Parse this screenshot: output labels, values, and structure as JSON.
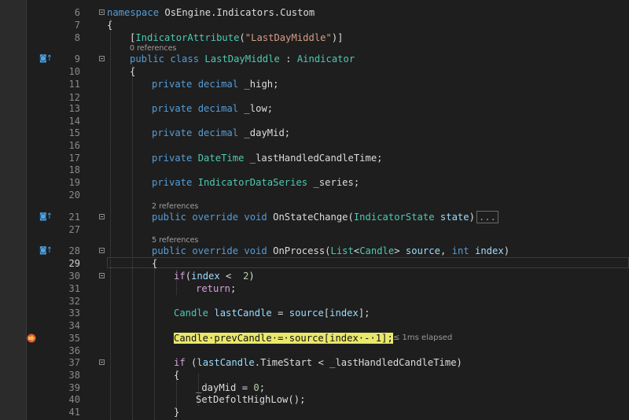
{
  "lines": [
    {
      "num": "6",
      "tokens": [
        [
          "kw",
          "namespace"
        ],
        [
          "pl",
          " OsEngine.Indicators.Custom"
        ]
      ]
    },
    {
      "num": "7",
      "tokens": [
        [
          "pl",
          "{"
        ]
      ]
    },
    {
      "num": "8",
      "tokens": [
        [
          "pl",
          "["
        ],
        [
          "ty",
          "IndicatorAttribute"
        ],
        [
          "pl",
          "("
        ],
        [
          "str",
          "\"LastDayMiddle\""
        ],
        [
          "pl",
          ")]"
        ]
      ]
    },
    {
      "num": "9",
      "tokens": [
        [
          "kw",
          "public"
        ],
        [
          "pl",
          " "
        ],
        [
          "kw",
          "class"
        ],
        [
          "pl",
          " "
        ],
        [
          "ty",
          "LastDayMiddle"
        ],
        [
          "pl",
          " : "
        ],
        [
          "ty",
          "Aindicator"
        ]
      ]
    },
    {
      "num": "10",
      "tokens": [
        [
          "pl",
          "{"
        ]
      ]
    },
    {
      "num": "11",
      "tokens": [
        [
          "kw",
          "private"
        ],
        [
          "pl",
          " "
        ],
        [
          "kw",
          "decimal"
        ],
        [
          "pl",
          " _high;"
        ]
      ]
    },
    {
      "num": "12",
      "tokens": []
    },
    {
      "num": "13",
      "tokens": [
        [
          "kw",
          "private"
        ],
        [
          "pl",
          " "
        ],
        [
          "kw",
          "decimal"
        ],
        [
          "pl",
          " _low;"
        ]
      ]
    },
    {
      "num": "14",
      "tokens": []
    },
    {
      "num": "15",
      "tokens": [
        [
          "kw",
          "private"
        ],
        [
          "pl",
          " "
        ],
        [
          "kw",
          "decimal"
        ],
        [
          "pl",
          " _dayMid;"
        ]
      ]
    },
    {
      "num": "16",
      "tokens": []
    },
    {
      "num": "17",
      "tokens": [
        [
          "kw",
          "private"
        ],
        [
          "pl",
          " "
        ],
        [
          "ty",
          "DateTime"
        ],
        [
          "pl",
          " _lastHandledCandleTime;"
        ]
      ]
    },
    {
      "num": "18",
      "tokens": []
    },
    {
      "num": "19",
      "tokens": [
        [
          "kw",
          "private"
        ],
        [
          "pl",
          " "
        ],
        [
          "ty",
          "IndicatorDataSeries"
        ],
        [
          "pl",
          " _series;"
        ]
      ]
    },
    {
      "num": "20",
      "tokens": []
    },
    {
      "num": "21",
      "tokens": [
        [
          "kw",
          "public"
        ],
        [
          "pl",
          " "
        ],
        [
          "kw",
          "override"
        ],
        [
          "pl",
          " "
        ],
        [
          "kw",
          "void"
        ],
        [
          "pl",
          " OnStateChange("
        ],
        [
          "ty",
          "IndicatorState"
        ],
        [
          "pm",
          " state"
        ],
        [
          "pl",
          ")"
        ]
      ],
      "collapsed": "..."
    },
    {
      "num": "27",
      "tokens": []
    },
    {
      "num": "28",
      "tokens": [
        [
          "kw",
          "public"
        ],
        [
          "pl",
          " "
        ],
        [
          "kw",
          "override"
        ],
        [
          "pl",
          " "
        ],
        [
          "kw",
          "void"
        ],
        [
          "pl",
          " OnProcess("
        ],
        [
          "ty",
          "List"
        ],
        [
          "pl",
          "<"
        ],
        [
          "ty",
          "Candle"
        ],
        [
          "pl",
          ">"
        ],
        [
          "pm",
          " source"
        ],
        [
          "pl",
          ", "
        ],
        [
          "kw",
          "int"
        ],
        [
          "pm",
          " index"
        ],
        [
          "pl",
          ")"
        ]
      ]
    },
    {
      "num": "29",
      "tokens": [
        [
          "pl",
          "{"
        ]
      ]
    },
    {
      "num": "30",
      "tokens": [
        [
          "ctl",
          "if"
        ],
        [
          "pl",
          "("
        ],
        [
          "pm",
          "index"
        ],
        [
          "pl",
          " <  "
        ],
        [
          "nm",
          "2"
        ],
        [
          "pl",
          ")"
        ]
      ]
    },
    {
      "num": "31",
      "tokens": [
        [
          "ctl",
          "return"
        ],
        [
          "pl",
          ";"
        ]
      ]
    },
    {
      "num": "32",
      "tokens": []
    },
    {
      "num": "33",
      "tokens": [
        [
          "ty",
          "Candle"
        ],
        [
          "pl",
          " "
        ],
        [
          "pm",
          "lastCandle"
        ],
        [
          "pl",
          " = "
        ],
        [
          "pm",
          "source"
        ],
        [
          "pl",
          "["
        ],
        [
          "pm",
          "index"
        ],
        [
          "pl",
          "];"
        ]
      ]
    },
    {
      "num": "34",
      "tokens": []
    },
    {
      "num": "35",
      "tokens": [
        [
          "hl",
          "Candle·prevCandle·=·source[index·-·1];"
        ]
      ]
    },
    {
      "num": "36",
      "tokens": []
    },
    {
      "num": "37",
      "tokens": [
        [
          "ctl",
          "if"
        ],
        [
          "pl",
          " ("
        ],
        [
          "pm",
          "lastCandle"
        ],
        [
          "pl",
          ".TimeStart < _lastHandledCandleTime)"
        ]
      ]
    },
    {
      "num": "38",
      "tokens": [
        [
          "pl",
          "{"
        ]
      ]
    },
    {
      "num": "39",
      "tokens": [
        [
          "pl",
          "_dayMid = "
        ],
        [
          "nm",
          "0"
        ],
        [
          "pl",
          ";"
        ]
      ]
    },
    {
      "num": "40",
      "tokens": [
        [
          "pl",
          "SetDefoltHighLow();"
        ]
      ]
    },
    {
      "num": "41",
      "tokens": [
        [
          "pl",
          "}"
        ]
      ]
    }
  ],
  "codelens": {
    "class_refs": "0 references",
    "onstatechange_refs": "2 references",
    "onprocess_refs": "5 references"
  },
  "perf_tip": "≤ 1ms elapsed",
  "margin_glyphs": {
    "line9": "◙↑",
    "line21": "◙↑",
    "line28": "◙↑"
  },
  "current_line": "29",
  "breakpoint_line": "35"
}
